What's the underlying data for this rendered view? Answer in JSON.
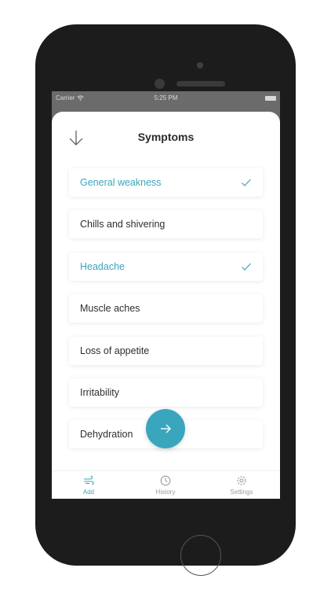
{
  "status_bar": {
    "carrier": "Carrier",
    "time": "5:25 PM"
  },
  "header": {
    "title": "Symptoms"
  },
  "symptoms": [
    {
      "label": "General weakness",
      "selected": true
    },
    {
      "label": "Chills and shivering",
      "selected": false
    },
    {
      "label": "Headache",
      "selected": true
    },
    {
      "label": "Muscle aches",
      "selected": false
    },
    {
      "label": "Loss of appetite",
      "selected": false
    },
    {
      "label": "Irritability",
      "selected": false
    },
    {
      "label": "Dehydration",
      "selected": false
    }
  ],
  "tabs": [
    {
      "label": "Add",
      "icon": "wind-icon",
      "active": true
    },
    {
      "label": "History",
      "icon": "clock-icon",
      "active": false
    },
    {
      "label": "Settings",
      "icon": "gear-icon",
      "active": false
    }
  ],
  "colors": {
    "accent": "#3aa6bd",
    "text": "#2e2e2e",
    "muted": "#9b9b9b",
    "phone_body": "#1c1c1c"
  },
  "fab": {
    "icon": "arrow-right-icon"
  }
}
